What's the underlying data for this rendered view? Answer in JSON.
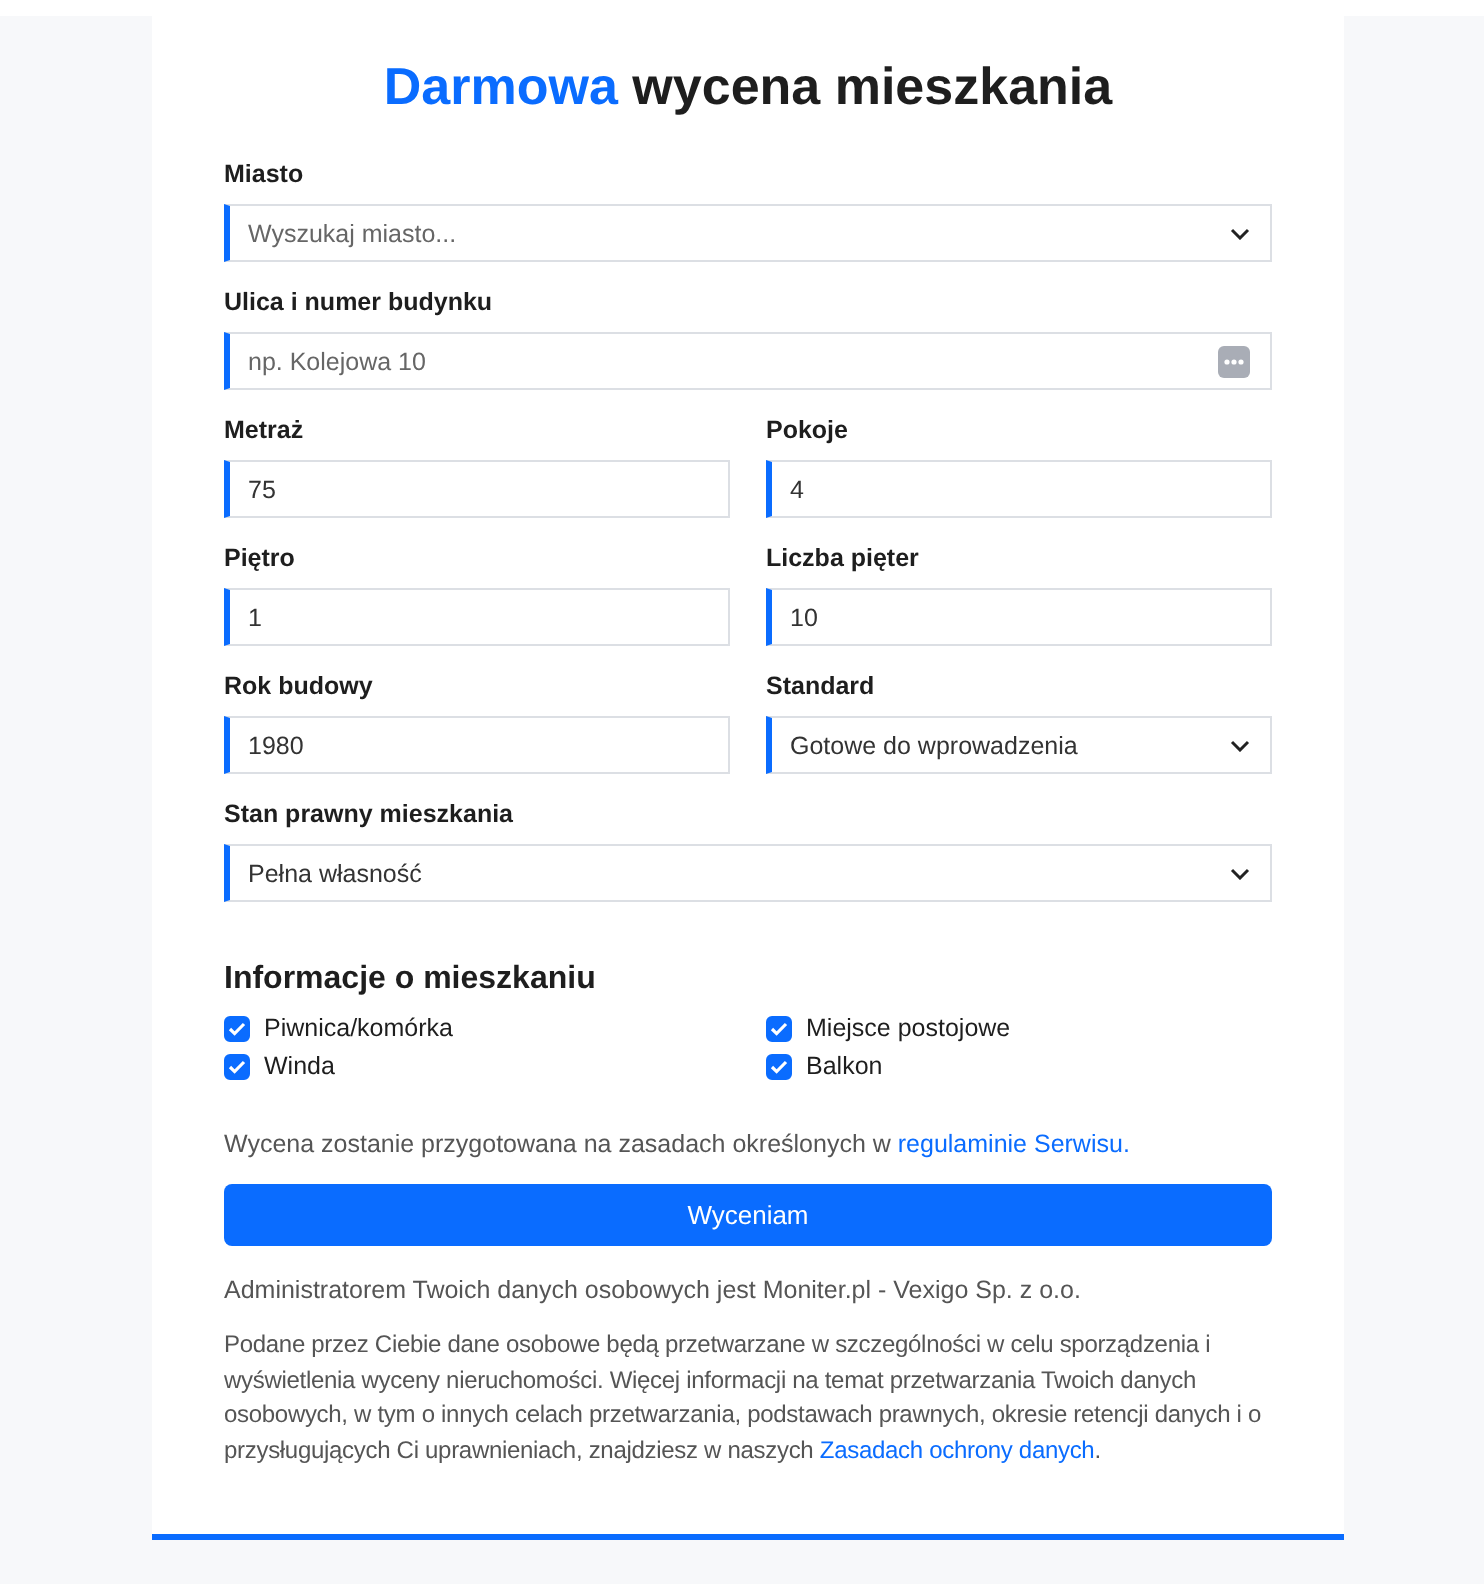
{
  "title": {
    "highlight": "Darmowa",
    "rest": "wycena mieszkania"
  },
  "rows": [
    [
      {
        "label": "Miasto",
        "kind": "select",
        "placeholder": "Wyszukaj miasto..."
      }
    ],
    [
      {
        "label": "Ulica i numer budynku",
        "kind": "address",
        "placeholder": "np. Kolejowa 10"
      }
    ],
    [
      {
        "label": "Metraż",
        "kind": "text",
        "value": "75"
      },
      {
        "label": "Pokoje",
        "kind": "text",
        "value": "4"
      }
    ],
    [
      {
        "label": "Piętro",
        "kind": "text",
        "value": "1"
      },
      {
        "label": "Liczba pięter",
        "kind": "text",
        "value": "10"
      }
    ],
    [
      {
        "label": "Rok budowy",
        "kind": "text",
        "value": "1980"
      },
      {
        "label": "Standard",
        "kind": "select",
        "value": "Gotowe do wprowadzenia"
      }
    ],
    [
      {
        "label": "Stan prawny mieszkania",
        "kind": "select",
        "value": "Pełna własność"
      }
    ]
  ],
  "features": {
    "heading": "Informacje o mieszkaniu",
    "items": [
      {
        "label": "Piwnica/komórka",
        "checked": true
      },
      {
        "label": "Miejsce postojowe",
        "checked": true
      },
      {
        "label": "Winda",
        "checked": true
      },
      {
        "label": "Balkon",
        "checked": true
      }
    ]
  },
  "terms": {
    "text": "Wycena zostanie przygotowana na zasadach określonych w ",
    "link": "regulaminie Serwisu."
  },
  "submit": "Wyceniam",
  "admin_note": "Administratorem Twoich danych osobowych jest Moniter.pl - Vexigo Sp. z o.o.",
  "privacy": {
    "text": "Podane przez Ciebie dane osobowe będą przetwarzane w szczególności w celu sporządzenia i wyświetlenia wyceny nieruchomości. Więcej informacji na temat przetwarzania Twoich danych osobowych, w tym o innych celach przetwarzania, podstawach prawnych, okresie retencji danych i o przysługujących Ci uprawnieniach, znajdziesz w naszych ",
    "link": "Zasadach ochrony danych",
    "after": "."
  }
}
